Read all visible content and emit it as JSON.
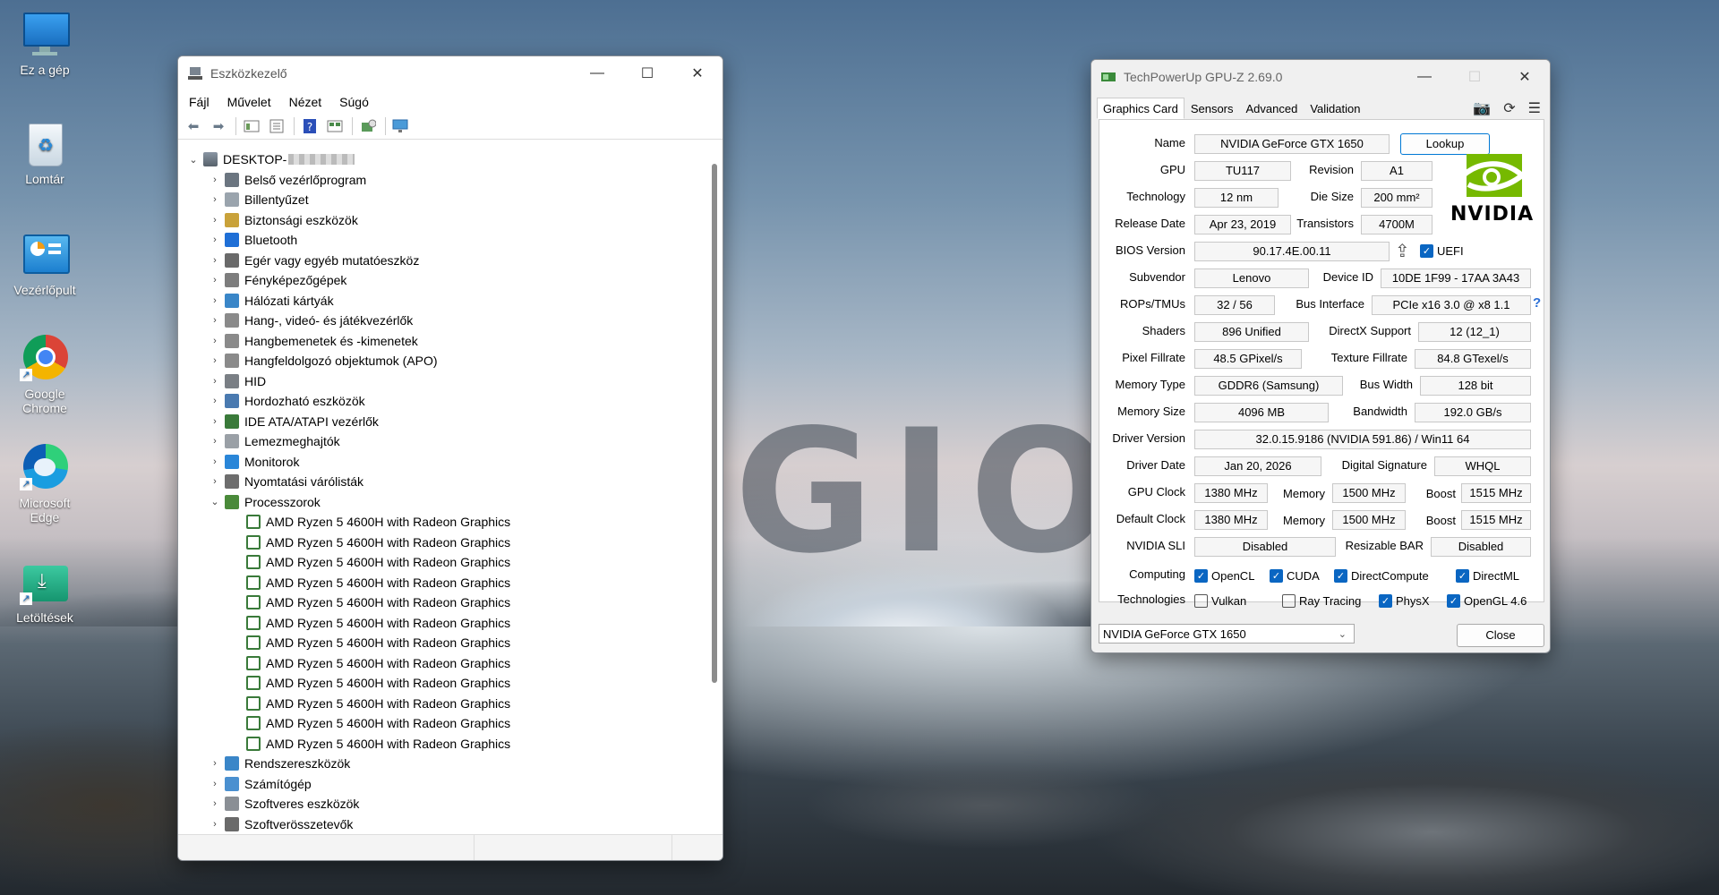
{
  "desktop": {
    "wallpaper_text": "GIO",
    "icons": [
      {
        "label": "Ez a gép",
        "icon": "computer-icon"
      },
      {
        "label": "Lomtár",
        "icon": "recycle-bin-icon"
      },
      {
        "label": "Vezérlőpult",
        "icon": "control-panel-icon"
      },
      {
        "label": "Google Chrome",
        "icon": "chrome-icon"
      },
      {
        "label": "Microsoft Edge",
        "icon": "edge-icon"
      },
      {
        "label": "Letöltések",
        "icon": "downloads-folder-icon"
      }
    ]
  },
  "devmgr": {
    "title": "Eszközkezelő",
    "menu": [
      "Fájl",
      "Művelet",
      "Nézet",
      "Súgó"
    ],
    "root": "DESKTOP-",
    "categories": [
      "Belső vezérlőprogram",
      "Billentyűzet",
      "Biztonsági eszközök",
      "Bluetooth",
      "Egér vagy egyéb mutatóeszköz",
      "Fényképezőgépek",
      "Hálózati kártyák",
      "Hang-, videó- és játékvezérlők",
      "Hangbemenetek és -kimenetek",
      "Hangfeldolgozó objektumok (APO)",
      "HID",
      "Hordozható eszközök",
      "IDE ATA/ATAPI vezérlők",
      "Lemezmeghajtók",
      "Monitorok",
      "Nyomtatási várólisták",
      "Processzorok"
    ],
    "cpu": [
      "AMD Ryzen 5 4600H with Radeon Graphics",
      "AMD Ryzen 5 4600H with Radeon Graphics",
      "AMD Ryzen 5 4600H with Radeon Graphics",
      "AMD Ryzen 5 4600H with Radeon Graphics",
      "AMD Ryzen 5 4600H with Radeon Graphics",
      "AMD Ryzen 5 4600H with Radeon Graphics",
      "AMD Ryzen 5 4600H with Radeon Graphics",
      "AMD Ryzen 5 4600H with Radeon Graphics",
      "AMD Ryzen 5 4600H with Radeon Graphics",
      "AMD Ryzen 5 4600H with Radeon Graphics",
      "AMD Ryzen 5 4600H with Radeon Graphics",
      "AMD Ryzen 5 4600H with Radeon Graphics"
    ],
    "after": [
      "Rendszereszközök",
      "Számítógép",
      "Szoftveres eszközök",
      "Szoftverösszetevők"
    ]
  },
  "gpuz": {
    "title": "TechPowerUp GPU-Z 2.69.0",
    "tabs": [
      "Graphics Card",
      "Sensors",
      "Advanced",
      "Validation"
    ],
    "labels": {
      "name": "Name",
      "gpu": "GPU",
      "revision": "Revision",
      "technology": "Technology",
      "die_size": "Die Size",
      "release_date": "Release Date",
      "transistors": "Transistors",
      "bios": "BIOS Version",
      "subvendor": "Subvendor",
      "device_id": "Device ID",
      "rops": "ROPs/TMUs",
      "bus_interface": "Bus Interface",
      "shaders": "Shaders",
      "directx": "DirectX Support",
      "pixel_fillrate": "Pixel Fillrate",
      "texture_fillrate": "Texture Fillrate",
      "memory_type": "Memory Type",
      "bus_width": "Bus Width",
      "memory_size": "Memory Size",
      "bandwidth": "Bandwidth",
      "driver_version": "Driver Version",
      "driver_date": "Driver Date",
      "digital_signature": "Digital Signature",
      "gpu_clock": "GPU Clock",
      "memory": "Memory",
      "boost": "Boost",
      "default_clock": "Default Clock",
      "sli": "NVIDIA SLI",
      "resizable_bar": "Resizable BAR",
      "computing": "Computing",
      "technologies": "Technologies"
    },
    "values": {
      "name": "NVIDIA GeForce GTX 1650",
      "gpu": "TU117",
      "revision": "A1",
      "technology": "12 nm",
      "die_size": "200 mm²",
      "release_date": "Apr 23, 2019",
      "transistors": "4700M",
      "bios": "90.17.4E.00.11",
      "subvendor": "Lenovo",
      "device_id": "10DE 1F99 - 17AA 3A43",
      "rops": "32 / 56",
      "bus_interface": "PCIe x16 3.0 @ x8 1.1",
      "shaders": "896 Unified",
      "directx": "12 (12_1)",
      "pixel_fillrate": "48.5 GPixel/s",
      "texture_fillrate": "84.8 GTexel/s",
      "memory_type": "GDDR6 (Samsung)",
      "bus_width": "128 bit",
      "memory_size": "4096 MB",
      "bandwidth": "192.0 GB/s",
      "driver_version": "32.0.15.9186 (NVIDIA 591.86) / Win11 64",
      "driver_date": "Jan 20, 2026",
      "digital_signature": "WHQL",
      "gpu_clock": "1380 MHz",
      "gpu_memory": "1500 MHz",
      "gpu_boost": "1515 MHz",
      "default_clock": "1380 MHz",
      "default_memory": "1500 MHz",
      "default_boost": "1515 MHz",
      "sli": "Disabled",
      "resizable_bar": "Disabled"
    },
    "lookup": "Lookup",
    "uefi": "UEFI",
    "bus_help": "?",
    "brand": "NVIDIA",
    "computing": [
      {
        "label": "OpenCL",
        "checked": true
      },
      {
        "label": "CUDA",
        "checked": true
      },
      {
        "label": "DirectCompute",
        "checked": true
      },
      {
        "label": "DirectML",
        "checked": true
      }
    ],
    "technologies": [
      {
        "label": "Vulkan",
        "checked": false
      },
      {
        "label": "Ray Tracing",
        "checked": false
      },
      {
        "label": "PhysX",
        "checked": true
      },
      {
        "label": "OpenGL 4.6",
        "checked": true
      }
    ],
    "selected_gpu": "NVIDIA GeForce GTX 1650",
    "close": "Close"
  }
}
